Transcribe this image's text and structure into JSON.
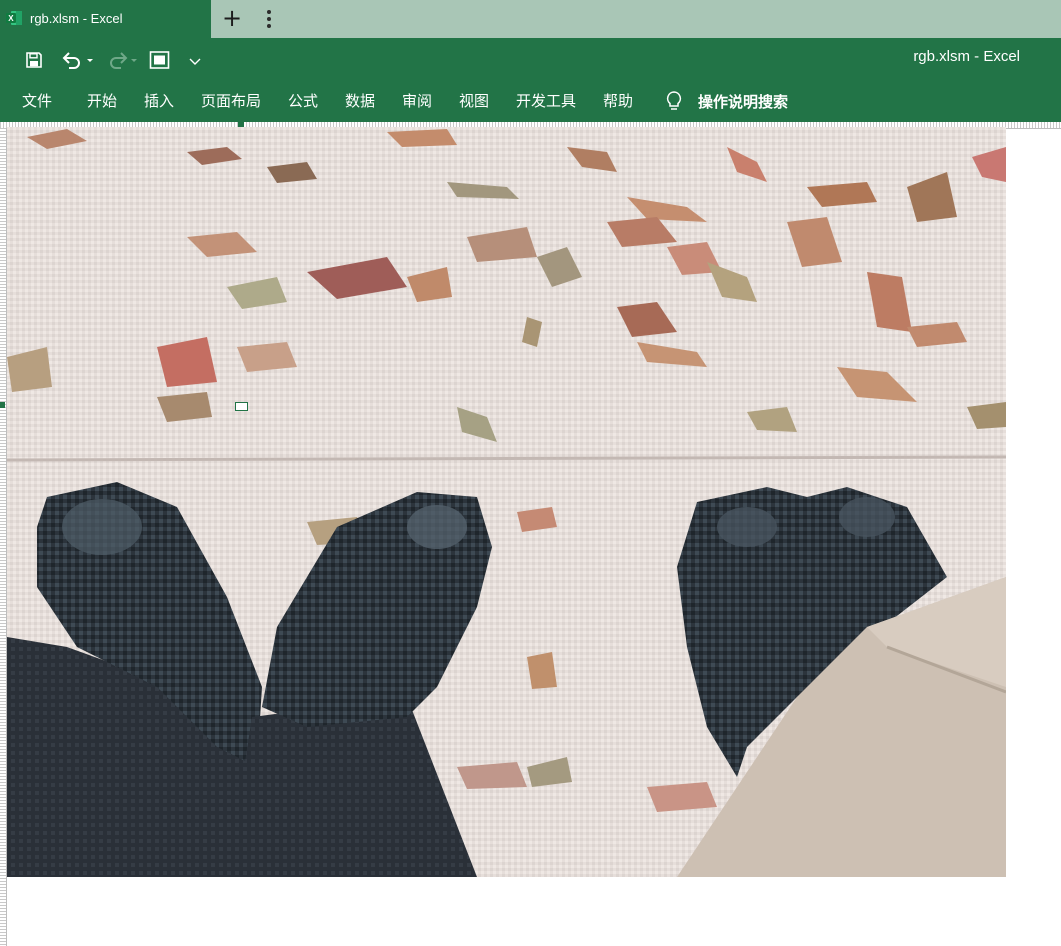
{
  "browser": {
    "tab_title": "rgb.xlsm - Excel",
    "tab_icon": "excel-icon",
    "new_tab_symbol": "+",
    "menu_icon": "kebab-menu-icon"
  },
  "ribbon": {
    "document_title": "rgb.xlsm  -  Excel",
    "quick_access": [
      "save-icon",
      "undo-icon",
      "redo-icon",
      "touch-mode-icon",
      "customize-quick-access-icon"
    ],
    "tabs": [
      {
        "label": "文件"
      },
      {
        "label": "开始"
      },
      {
        "label": "插入"
      },
      {
        "label": "页面布局"
      },
      {
        "label": "公式"
      },
      {
        "label": "数据"
      },
      {
        "label": "审阅"
      },
      {
        "label": "视图"
      },
      {
        "label": "开发工具"
      },
      {
        "label": "帮助"
      }
    ],
    "search_icon": "lightbulb-icon",
    "search_label": "操作说明搜索"
  },
  "sheet": {
    "content": "pixelated-photo-of-shoes-on-leaf-covered-pavement"
  },
  "colors": {
    "excel_green": "#227447",
    "tab_strip": "#a9c6b6",
    "ribbon_text": "#ffffff"
  }
}
